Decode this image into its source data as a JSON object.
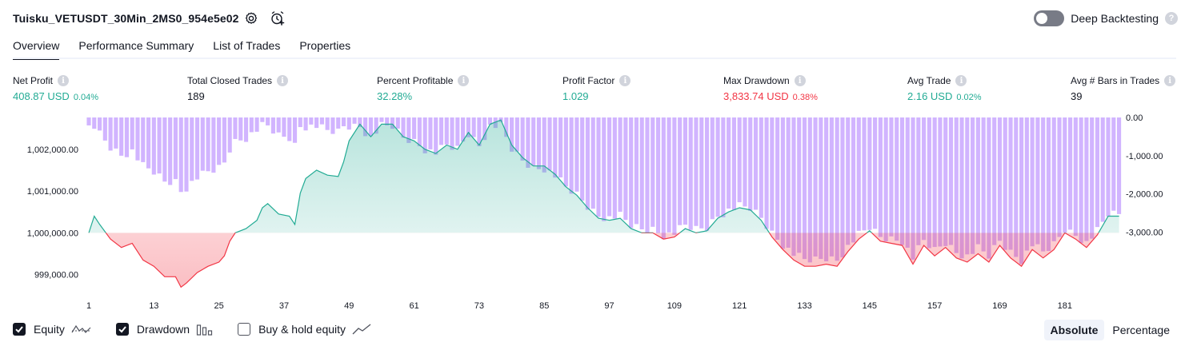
{
  "header": {
    "title": "Tuisku_VETUSDT_30Min_2MS0_954e5e02",
    "deep_backtesting_label": "Deep Backtesting",
    "deep_backtesting_enabled": false,
    "help_glyph": "?",
    "settings_icon": "gear-icon",
    "alert_icon": "add-alert-icon"
  },
  "tabs": [
    {
      "label": "Overview",
      "active": true
    },
    {
      "label": "Performance Summary",
      "active": false
    },
    {
      "label": "List of Trades",
      "active": false
    },
    {
      "label": "Properties",
      "active": false
    }
  ],
  "metrics": [
    {
      "label": "Net Profit",
      "value": "408.87 USD",
      "sub": "0.04%",
      "tone": "green"
    },
    {
      "label": "Total Closed Trades",
      "value": "189",
      "sub": "",
      "tone": "dark"
    },
    {
      "label": "Percent Profitable",
      "value": "32.28%",
      "sub": "",
      "tone": "green"
    },
    {
      "label": "Profit Factor",
      "value": "1.029",
      "sub": "",
      "tone": "green"
    },
    {
      "label": "Max Drawdown",
      "value": "3,833.74 USD",
      "sub": "0.38%",
      "tone": "red"
    },
    {
      "label": "Avg Trade",
      "value": "2.16 USD",
      "sub": "0.02%",
      "tone": "green"
    },
    {
      "label": "Avg # Bars in Trades",
      "value": "39",
      "sub": "",
      "tone": "dark"
    }
  ],
  "info_glyph": "i",
  "chart_data": {
    "type": "line",
    "x_tick_labels": [
      "1",
      "13",
      "25",
      "37",
      "49",
      "61",
      "73",
      "85",
      "97",
      "109",
      "121",
      "133",
      "145",
      "157",
      "169",
      "181"
    ],
    "x_range": [
      1,
      189
    ],
    "left_axis": {
      "tick_labels": [
        "1,002,000.00",
        "1,001,000.00",
        "1,000,000.00",
        "999,000.00"
      ],
      "tick_values": [
        1002000,
        1001000,
        1000000,
        999000
      ],
      "range": [
        998650,
        1002760
      ]
    },
    "right_axis": {
      "tick_labels": [
        "0.00",
        "-1,000.00",
        "-2,000.00",
        "-3,000.00"
      ],
      "tick_values": [
        0,
        -1000,
        -2000,
        -3000
      ],
      "range": [
        -4500,
        0
      ]
    },
    "equity_baseline": 1000000,
    "equity_keypoints": [
      [
        1,
        1000000
      ],
      [
        2,
        1000400
      ],
      [
        3,
        1000200
      ],
      [
        5,
        999850
      ],
      [
        7,
        999650
      ],
      [
        9,
        999750
      ],
      [
        11,
        999350
      ],
      [
        13,
        999200
      ],
      [
        15,
        998950
      ],
      [
        17,
        998950
      ],
      [
        18,
        998700
      ],
      [
        19,
        998800
      ],
      [
        21,
        999050
      ],
      [
        23,
        999200
      ],
      [
        25,
        999300
      ],
      [
        26,
        999450
      ],
      [
        27,
        999800
      ],
      [
        28,
        1000000
      ],
      [
        30,
        1000100
      ],
      [
        32,
        1000300
      ],
      [
        33,
        1000600
      ],
      [
        34,
        1000700
      ],
      [
        36,
        1000450
      ],
      [
        38,
        1000400
      ],
      [
        39,
        1000200
      ],
      [
        40,
        1000950
      ],
      [
        41,
        1001300
      ],
      [
        43,
        1001500
      ],
      [
        45,
        1001380
      ],
      [
        47,
        1001350
      ],
      [
        48,
        1001700
      ],
      [
        49,
        1002200
      ],
      [
        51,
        1002600
      ],
      [
        53,
        1002300
      ],
      [
        55,
        1002600
      ],
      [
        57,
        1002600
      ],
      [
        59,
        1002300
      ],
      [
        61,
        1002200
      ],
      [
        63,
        1002000
      ],
      [
        65,
        1001900
      ],
      [
        67,
        1002100
      ],
      [
        69,
        1002000
      ],
      [
        71,
        1002400
      ],
      [
        73,
        1002100
      ],
      [
        75,
        1002600
      ],
      [
        77,
        1002700
      ],
      [
        79,
        1002100
      ],
      [
        81,
        1001800
      ],
      [
        83,
        1001600
      ],
      [
        85,
        1001600
      ],
      [
        87,
        1001400
      ],
      [
        89,
        1001100
      ],
      [
        91,
        1000900
      ],
      [
        93,
        1000600
      ],
      [
        95,
        1000350
      ],
      [
        97,
        1000300
      ],
      [
        99,
        1000350
      ],
      [
        101,
        1000100
      ],
      [
        103,
        1000000
      ],
      [
        105,
        1000000
      ],
      [
        107,
        999850
      ],
      [
        109,
        999900
      ],
      [
        111,
        1000100
      ],
      [
        113,
        1000000
      ],
      [
        115,
        1000050
      ],
      [
        117,
        1000350
      ],
      [
        119,
        1000500
      ],
      [
        121,
        1000600
      ],
      [
        123,
        1000550
      ],
      [
        125,
        1000300
      ],
      [
        127,
        999900
      ],
      [
        129,
        999600
      ],
      [
        131,
        999350
      ],
      [
        133,
        999200
      ],
      [
        135,
        999200
      ],
      [
        137,
        999250
      ],
      [
        139,
        999200
      ],
      [
        141,
        999550
      ],
      [
        143,
        999850
      ],
      [
        145,
        1000050
      ],
      [
        147,
        999800
      ],
      [
        149,
        999750
      ],
      [
        151,
        999700
      ],
      [
        153,
        999250
      ],
      [
        155,
        999700
      ],
      [
        157,
        999450
      ],
      [
        159,
        999650
      ],
      [
        161,
        999400
      ],
      [
        163,
        999300
      ],
      [
        165,
        999500
      ],
      [
        167,
        999300
      ],
      [
        169,
        999700
      ],
      [
        171,
        999400
      ],
      [
        173,
        999200
      ],
      [
        175,
        999600
      ],
      [
        177,
        999400
      ],
      [
        179,
        999600
      ],
      [
        181,
        1000000
      ],
      [
        183,
        999850
      ],
      [
        185,
        999650
      ],
      [
        187,
        999950
      ],
      [
        189,
        1000400
      ],
      [
        191,
        1000400
      ]
    ],
    "series": [
      {
        "name": "Equity",
        "color_up": "#22ab94",
        "color_down": "#f23645"
      },
      {
        "name": "Drawdown",
        "color": "#c9a7ff"
      }
    ],
    "grid": false
  },
  "legend": [
    {
      "label": "Equity",
      "checked": true,
      "icon": "equity-line-icon"
    },
    {
      "label": "Drawdown",
      "checked": true,
      "icon": "drawdown-bars-icon"
    },
    {
      "label": "Buy & hold equity",
      "checked": false,
      "icon": "buy-hold-line-icon"
    }
  ],
  "mode": {
    "absolute_label": "Absolute",
    "percentage_label": "Percentage",
    "selected": "Absolute"
  }
}
